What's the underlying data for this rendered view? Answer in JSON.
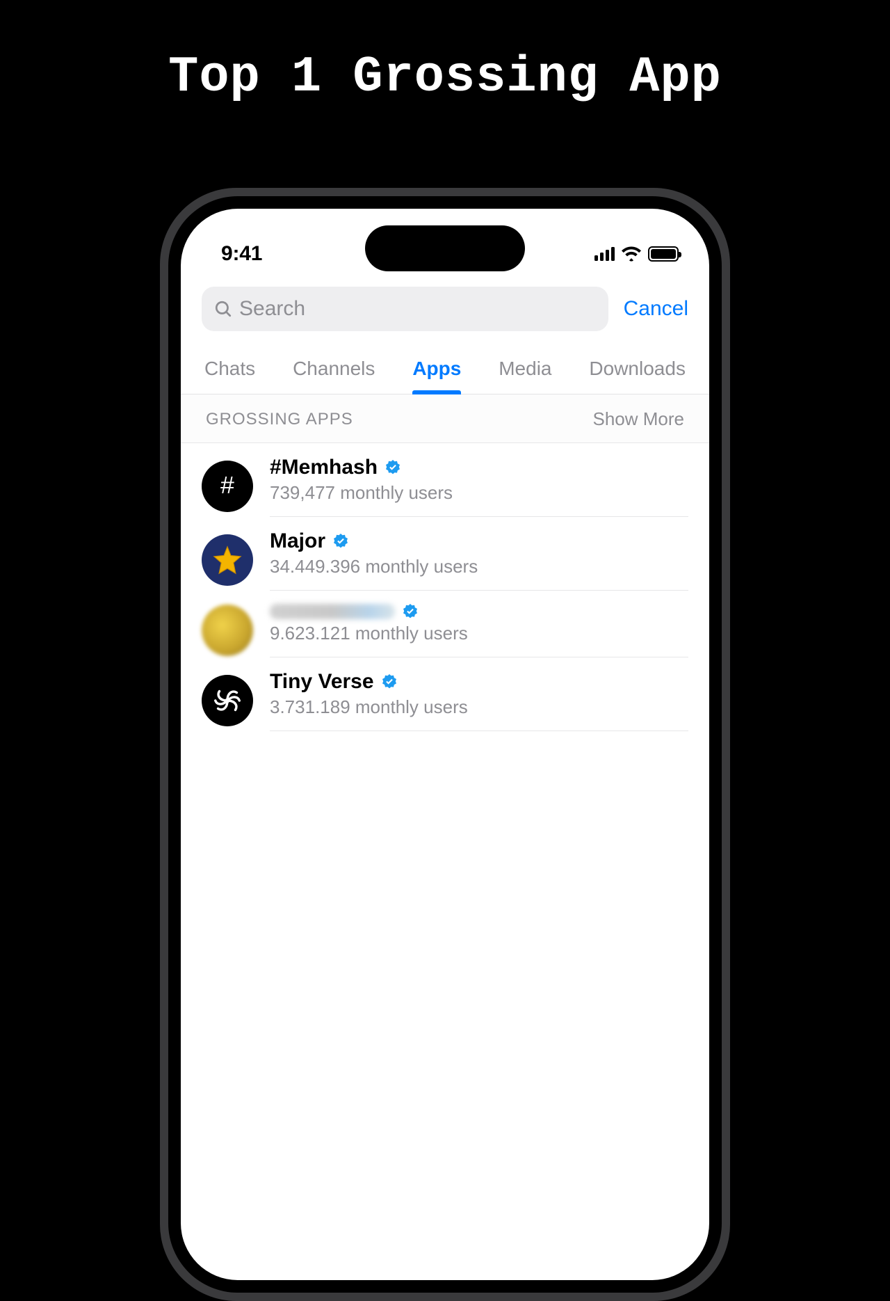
{
  "headline": "Top 1 Grossing App",
  "status": {
    "time": "9:41"
  },
  "search": {
    "placeholder": "Search",
    "cancel": "Cancel"
  },
  "tabs": [
    {
      "label": "Chats",
      "active": false
    },
    {
      "label": "Channels",
      "active": false
    },
    {
      "label": "Apps",
      "active": true
    },
    {
      "label": "Media",
      "active": false
    },
    {
      "label": "Downloads",
      "active": false
    }
  ],
  "section": {
    "title": "GROSSING APPS",
    "show_more": "Show More"
  },
  "apps": [
    {
      "name": "#Memhash",
      "sub": "739,477 monthly users",
      "verified": true,
      "avatar": "memhash",
      "blurred": false
    },
    {
      "name": "Major",
      "sub": "34.449.396 monthly users",
      "verified": true,
      "avatar": "major",
      "blurred": false
    },
    {
      "name": "",
      "sub": "9.623.121 monthly users",
      "verified": true,
      "avatar": "blur",
      "blurred": true
    },
    {
      "name": "Tiny Verse",
      "sub": "3.731.189 monthly users",
      "verified": true,
      "avatar": "tiny",
      "blurred": false
    }
  ]
}
